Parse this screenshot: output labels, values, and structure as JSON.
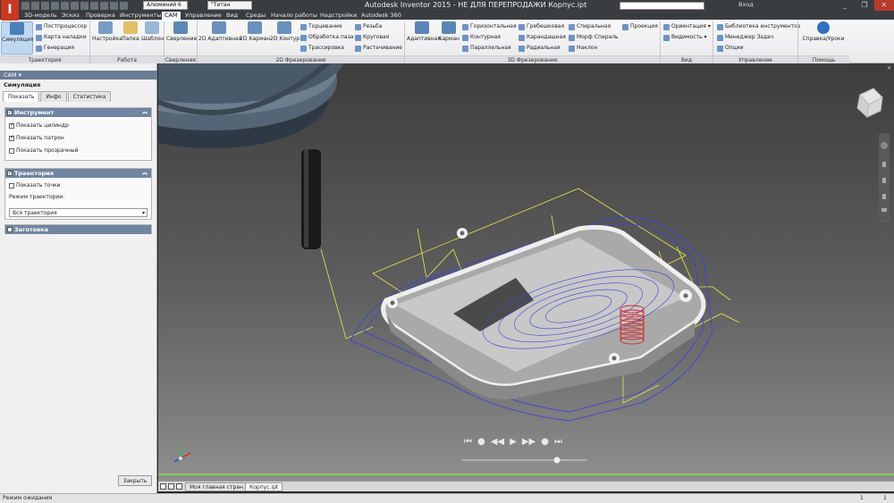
{
  "app": {
    "window_title": "Autodesk Inventor 2015 - НЕ ДЛЯ ПЕРЕПРОДАЖИ    Корпус.ipt",
    "logo": "I",
    "material_combo": "Алюминий 6",
    "appearance_combo": "\"Титан",
    "user_label": "Вход",
    "window_controls": [
      "_",
      "❐",
      "✕"
    ]
  },
  "menu_tabs": [
    {
      "label": "3D-модель"
    },
    {
      "label": "Эскиз"
    },
    {
      "label": "Проверка"
    },
    {
      "label": "Инструменты"
    },
    {
      "label": "CAM",
      "active": true
    },
    {
      "label": "Управление"
    },
    {
      "label": "Вид"
    },
    {
      "label": "Среды"
    },
    {
      "label": "Начало работы"
    },
    {
      "label": "Надстройки"
    },
    {
      "label": "Autodesk 360"
    }
  ],
  "ribbon": {
    "groups": [
      {
        "label": "Траектория"
      },
      {
        "label": "Работа"
      },
      {
        "label": "Сверление"
      },
      {
        "label": "2D Фрезерование"
      },
      {
        "label": "3D Фрезерование"
      },
      {
        "label": "Вид"
      },
      {
        "label": "Управление"
      },
      {
        "label": "Помощь"
      }
    ],
    "trajectory": {
      "simulate": "Симуляция",
      "postprocessor": "Постпроцессор",
      "setup_sheet": "Карта наладки",
      "generate": "Генерация"
    },
    "work": {
      "setup": "Настройка",
      "folder": "Папка",
      "template": "Шаблон"
    },
    "drilling": {
      "drill": "Сверление"
    },
    "milling2d": {
      "adaptive2d": "2D Адаптивная",
      "pocket2d": "2D Карман",
      "contour2d": "2D Контур",
      "facing": "Торцевание",
      "slot": "Обработка паза",
      "trace": "Трассировка",
      "thread": "Резьба",
      "circular": "Круговая",
      "bore": "Растачивание"
    },
    "milling3d": {
      "adaptive": "Адаптивная",
      "pocket": "Карман",
      "horizontal": "Горизонтальная",
      "contour": "Контурная",
      "parallel": "Параллельная",
      "scallop": "Гребешковая",
      "pencil": "Карандашная",
      "radial": "Радиальная",
      "spiral": "Спиральная",
      "morph_spiral": "Морф Спираль",
      "ramp": "Наклон",
      "projection": "Проекция"
    },
    "view": {
      "orientation": "Ориентация",
      "visibility": "Видимость"
    },
    "manage": {
      "tool_library": "Библиотека инструментов",
      "task_manager": "Менеджер Задач",
      "options": "Опции"
    },
    "help": {
      "help": "Справка/Уроки"
    }
  },
  "panel": {
    "title": "CAM",
    "subtitle": "Симуляция",
    "tabs": [
      {
        "label": "Показать",
        "active": true
      },
      {
        "label": "Инфо"
      },
      {
        "label": "Статистика"
      }
    ],
    "sections": {
      "tool": {
        "title": "Инструмент",
        "checked": true,
        "options": [
          {
            "label": "Показать цилиндр",
            "checked": true
          },
          {
            "label": "Показать патрон",
            "checked": true
          },
          {
            "label": "Показать прозрачный",
            "checked": false
          }
        ]
      },
      "trajectory": {
        "title": "Траектория",
        "checked": true,
        "show_points": {
          "label": "Показать точки",
          "checked": false
        },
        "mode_label": "Режим траектории:",
        "mode_value": "Вся траектория"
      },
      "stock": {
        "title": "Заготовка",
        "checked": false
      }
    },
    "close_button": "Закрыть"
  },
  "viewport": {
    "close_glyph": "✕",
    "playback": [
      "⏮",
      "●",
      "◀◀",
      "▶",
      "▶▶",
      "●",
      "⏭"
    ],
    "colors": {
      "toolpath": "#e8e84a",
      "contour": "#3a44d8",
      "drill": "#d42a2a",
      "part": "#d9d9d9",
      "timeline": "#7fd14a"
    }
  },
  "doc_tabs": [
    {
      "label": "Моя главная стран..."
    },
    {
      "label": "Корпус.ipt",
      "active": true
    }
  ],
  "status": {
    "text": "Режим ожидания",
    "count1": "1",
    "count2": "1"
  }
}
